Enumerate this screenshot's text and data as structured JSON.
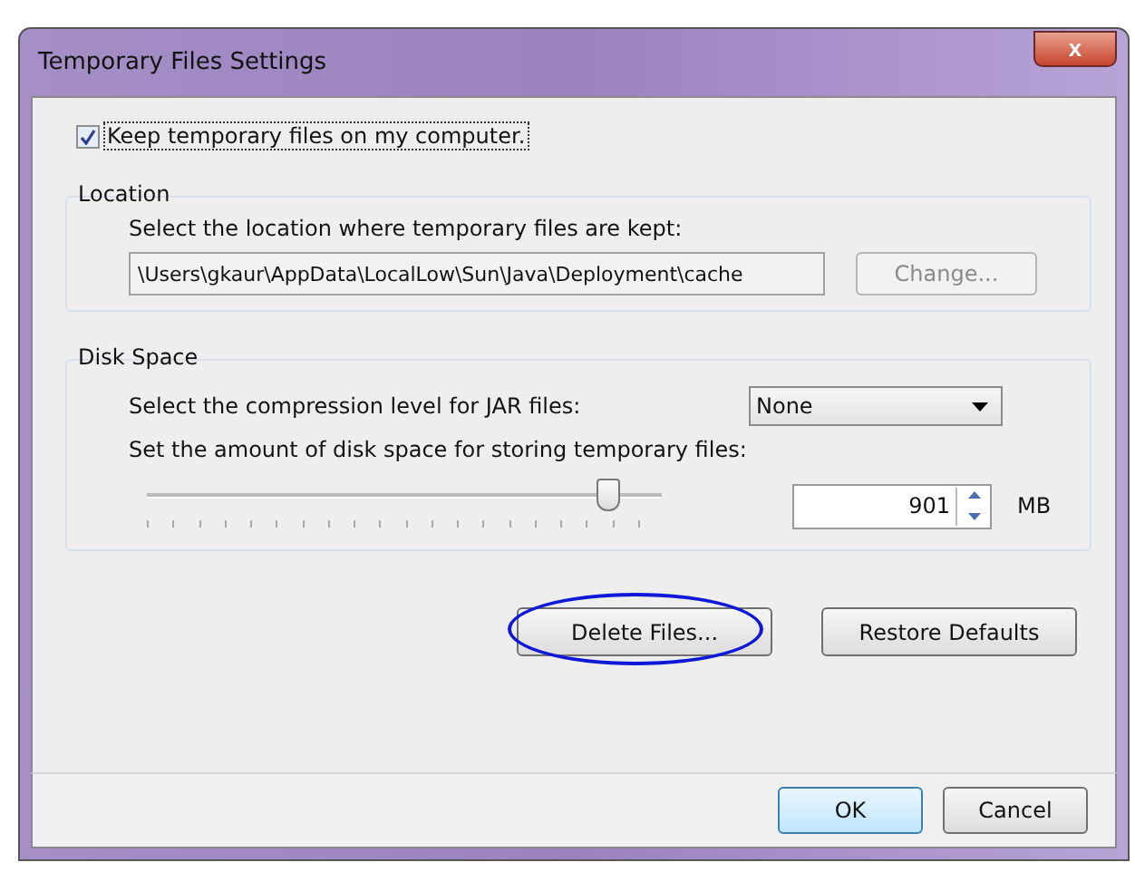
{
  "window": {
    "title": "Temporary Files Settings",
    "close": "x"
  },
  "keep_files": {
    "label": "Keep temporary files on my computer.",
    "checked": true
  },
  "location": {
    "legend": "Location",
    "prompt": "Select the location where temporary files are kept:",
    "path": "\\Users\\gkaur\\AppData\\LocalLow\\Sun\\Java\\Deployment\\cache",
    "change_button": {
      "label": "Change...",
      "disabled": true
    }
  },
  "disk_space": {
    "legend": "Disk Space",
    "compression_label": "Select the compression level for JAR files:",
    "compression_value": "None",
    "amount_label": "Set the amount of disk space for storing temporary files:",
    "slider": {
      "level": 0.9
    },
    "amount_value": "901",
    "unit": "MB"
  },
  "actions": [
    {
      "label": "Delete Files...",
      "highlighted": true
    },
    {
      "label": "Restore Defaults",
      "highlighted": false
    }
  ],
  "buttons": [
    {
      "label": "OK",
      "default": true
    },
    {
      "label": "Cancel",
      "default": false
    }
  ]
}
